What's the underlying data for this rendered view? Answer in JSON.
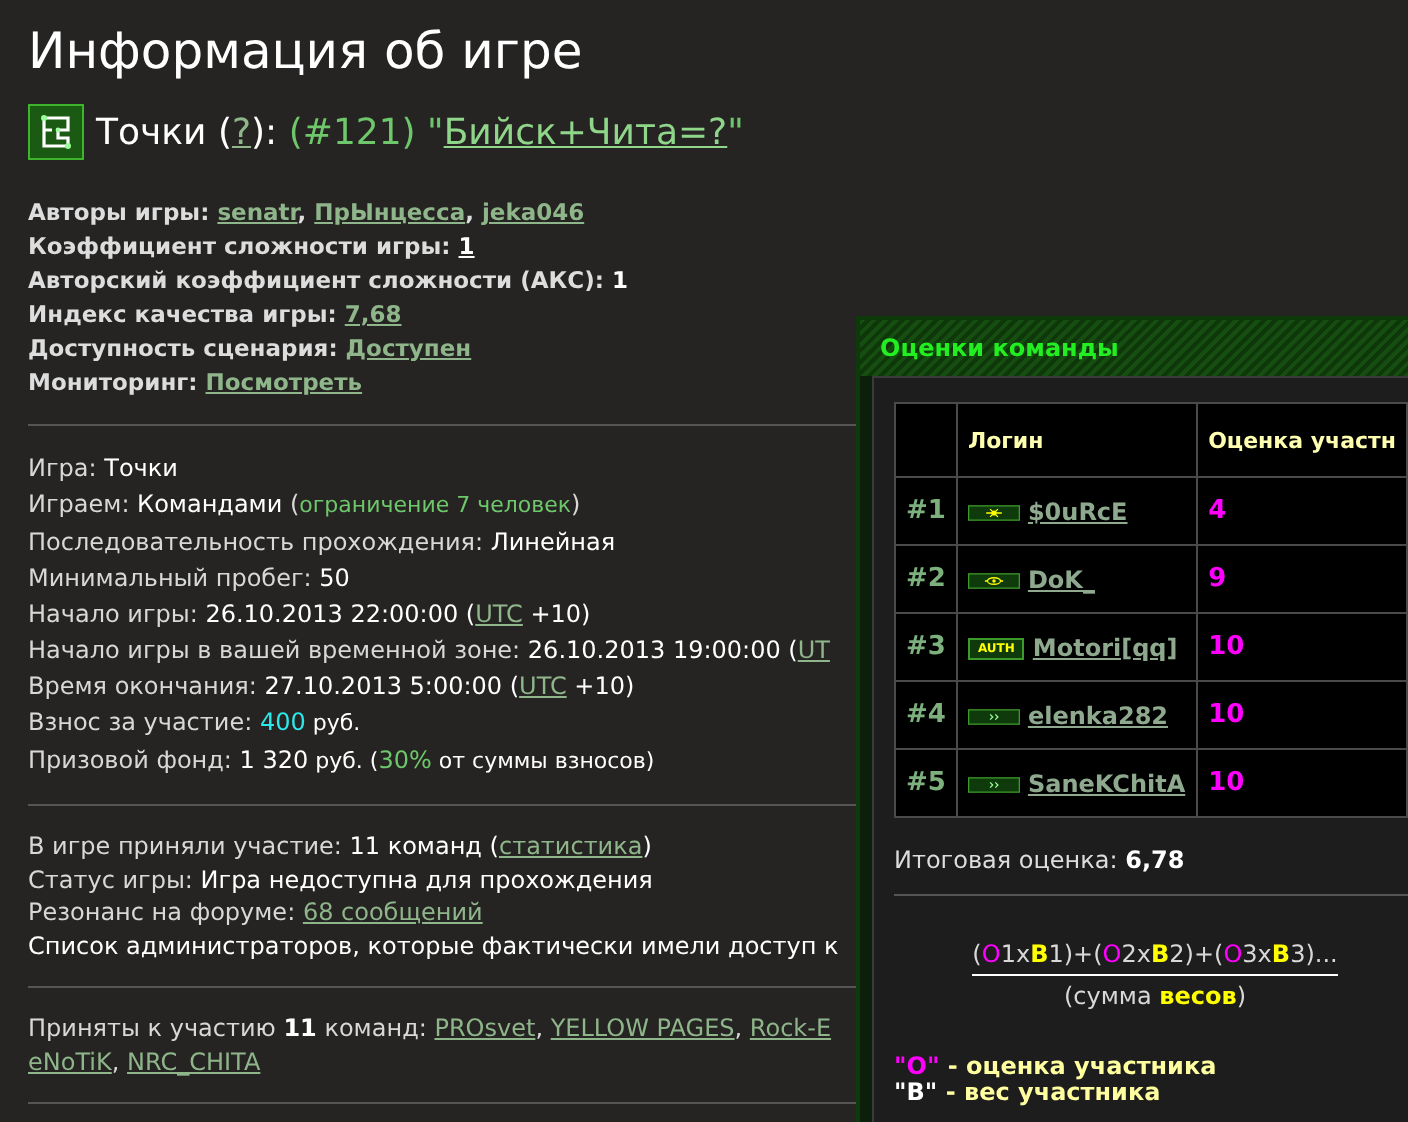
{
  "page_title": "Информация об игре",
  "game_line": [
    {
      "text": "Точки ",
      "kind": "strong"
    },
    {
      "text": "(",
      "kind": "strong"
    },
    {
      "text": "?",
      "kind": "link"
    },
    {
      "text": "): ",
      "kind": "strong"
    },
    {
      "text": "(#121) \"",
      "kind": "green"
    },
    {
      "text": "Бийск+Чита=?",
      "kind": "linkgreen"
    },
    {
      "text": "\"",
      "kind": "green"
    }
  ],
  "sections": [
    {
      "kind": "bold",
      "lines": [
        [
          {
            "text": "Авторы игры: ",
            "kind": "plain"
          },
          {
            "text": "senatr",
            "kind": "link"
          },
          {
            "text": ", ",
            "kind": "plain"
          },
          {
            "text": "ПрЫнцесса",
            "kind": "link"
          },
          {
            "text": ", ",
            "kind": "plain"
          },
          {
            "text": "jeka046",
            "kind": "link"
          }
        ],
        [
          {
            "text": "Коэффициент сложности игры: ",
            "kind": "plain"
          },
          {
            "text": "1",
            "kind": "linkwhite"
          }
        ],
        [
          {
            "text": "Авторский коэффициент сложности (АКС): ",
            "kind": "plain"
          },
          {
            "text": "1",
            "kind": "strong"
          }
        ],
        [
          {
            "text": "Индекс качества игры: ",
            "kind": "plain"
          },
          {
            "text": "7,68",
            "kind": "link"
          }
        ],
        [
          {
            "text": "Доступность сценария: ",
            "kind": "plain"
          },
          {
            "text": "Доступен",
            "kind": "link"
          }
        ],
        [
          {
            "text": "Мониторинг: ",
            "kind": "plain"
          },
          {
            "text": "Посмотреть",
            "kind": "link"
          }
        ]
      ]
    },
    {
      "kind": "normal",
      "lines": [
        [
          {
            "text": "Игра: ",
            "kind": "plain"
          },
          {
            "text": "Точки",
            "kind": "strong"
          }
        ],
        [
          {
            "text": "Играем: ",
            "kind": "plain"
          },
          {
            "text": "Командами",
            "kind": "strong"
          },
          {
            "text": " (",
            "kind": "plain"
          },
          {
            "text": "ограничение 7 человек",
            "kind": "greensmall"
          },
          {
            "text": ")",
            "kind": "plain"
          }
        ],
        [
          {
            "text": "Последовательность прохождения: ",
            "kind": "plain"
          },
          {
            "text": "Линейная",
            "kind": "strong"
          }
        ],
        [
          {
            "text": "Минимальный пробег: ",
            "kind": "plain"
          },
          {
            "text": "50",
            "kind": "strong"
          }
        ],
        [
          {
            "text": "Начало игры: ",
            "kind": "plain"
          },
          {
            "text": "26.10.2013 22:00:00 (",
            "kind": "strong"
          },
          {
            "text": "UTC",
            "kind": "link"
          },
          {
            "text": " +10)",
            "kind": "strong"
          }
        ],
        [
          {
            "text": "Начало игры в вашей временной зоне: ",
            "kind": "plain"
          },
          {
            "text": "26.10.2013 19:00:00 (",
            "kind": "strong"
          },
          {
            "text": "UT",
            "kind": "link"
          }
        ],
        [
          {
            "text": "Время окончания: ",
            "kind": "plain"
          },
          {
            "text": "27.10.2013 5:00:00 (",
            "kind": "strong"
          },
          {
            "text": "UTC",
            "kind": "link"
          },
          {
            "text": " +10)",
            "kind": "strong"
          }
        ],
        [
          {
            "text": "Взнос за участие: ",
            "kind": "plain"
          },
          {
            "text": "400",
            "kind": "cyan"
          },
          {
            "text": " руб.",
            "kind": "strongsmall"
          }
        ],
        [
          {
            "text": "Призовой фонд: ",
            "kind": "plain"
          },
          {
            "text": "1 320",
            "kind": "strong"
          },
          {
            "text": " руб. (",
            "kind": "strongsmall"
          },
          {
            "text": "30%",
            "kind": "green"
          },
          {
            "text": " от суммы взносов)",
            "kind": "strongsmall"
          }
        ]
      ]
    },
    {
      "kind": "tight",
      "lines": [
        [
          {
            "text": "В игре приняли участие: ",
            "kind": "plain"
          },
          {
            "text": "11 команд",
            "kind": "strong"
          },
          {
            "text": " (",
            "kind": "strong"
          },
          {
            "text": "статистика",
            "kind": "link"
          },
          {
            "text": ")",
            "kind": "strong"
          }
        ],
        [
          {
            "text": "Статус игры: ",
            "kind": "plain"
          },
          {
            "text": "Игра недоступна для прохождения",
            "kind": "strong"
          }
        ],
        [
          {
            "text": "Резонанс на форуме: ",
            "kind": "plain"
          },
          {
            "text": "68 сообщений",
            "kind": "link"
          }
        ],
        [
          {
            "text": "Список администраторов, которые фактически имели доступ к",
            "kind": "strong"
          }
        ]
      ]
    },
    {
      "kind": "tight",
      "lines": [
        [
          {
            "text": "Приняты к участию ",
            "kind": "plain"
          },
          {
            "text": "11",
            "kind": "bold"
          },
          {
            "text": " команд: ",
            "kind": "plain"
          },
          {
            "text": "PROsvet",
            "kind": "link"
          },
          {
            "text": ", ",
            "kind": "plain"
          },
          {
            "text": "YELLOW PAGES",
            "kind": "link"
          },
          {
            "text": ", ",
            "kind": "plain"
          },
          {
            "text": "Rock-E",
            "kind": "link"
          },
          {
            "kind": "break"
          },
          {
            "text": "eNoTiK",
            "kind": "link"
          },
          {
            "text": ", ",
            "kind": "plain"
          },
          {
            "text": "NRC_CHITA",
            "kind": "link"
          }
        ]
      ]
    }
  ],
  "team_ratings": {
    "title": "Оценки команды",
    "columns": [
      "Логин",
      "Оценка участн"
    ],
    "rows": [
      {
        "rank": "#1",
        "kind": "sun",
        "login": "$0uRcE",
        "score": "4"
      },
      {
        "rank": "#2",
        "kind": "eye",
        "login": "DoK_",
        "score": "9"
      },
      {
        "rank": "#3",
        "kind": "text",
        "badge_text": "AUTH",
        "login": "Motori[qq]",
        "score": "10"
      },
      {
        "rank": "#4",
        "kind": "chevron",
        "login": "elenka282",
        "score": "10"
      },
      {
        "rank": "#5",
        "kind": "chevron",
        "login": "SaneKChitA",
        "score": "10"
      }
    ],
    "total_label": "Итоговая оценка: ",
    "total_value": "6,78",
    "numerator": [
      {
        "text": "(",
        "kind": "plain"
      },
      {
        "text": "О",
        "kind": "o"
      },
      {
        "text": "1x",
        "kind": "plain"
      },
      {
        "text": "В",
        "kind": "b"
      },
      {
        "text": "1)+(",
        "kind": "plain"
      },
      {
        "text": "О",
        "kind": "o"
      },
      {
        "text": "2x",
        "kind": "plain"
      },
      {
        "text": "В",
        "kind": "b"
      },
      {
        "text": "2)+(",
        "kind": "plain"
      },
      {
        "text": "О",
        "kind": "o"
      },
      {
        "text": "3x",
        "kind": "plain"
      },
      {
        "text": "В",
        "kind": "b"
      },
      {
        "text": "3)...",
        "kind": "plain"
      }
    ],
    "denominator": [
      {
        "text": "(сумма ",
        "kind": "plain"
      },
      {
        "text": "весов",
        "kind": "b"
      },
      {
        "text": ")",
        "kind": "plain"
      }
    ],
    "legend": [
      [
        {
          "text": "\"О\"",
          "kind": "o"
        },
        {
          "text": " - оценка участника",
          "kind": "note"
        }
      ],
      [
        {
          "text": "\"В\"",
          "kind": "quote"
        },
        {
          "text": " - вес участника",
          "kind": "note"
        }
      ]
    ]
  }
}
